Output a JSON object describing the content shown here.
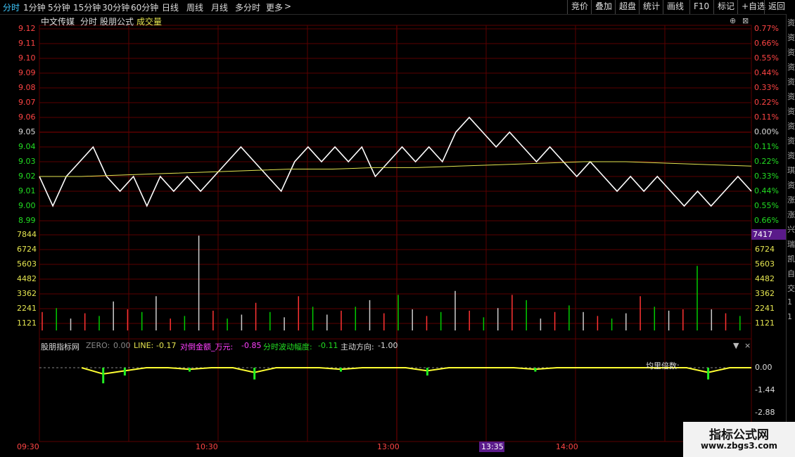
{
  "topbar": {
    "periods": [
      "分时",
      "1分钟",
      "5分钟",
      "15分钟",
      "30分钟",
      "60分钟",
      "日线",
      "周线",
      "月线",
      "多分时",
      "更多"
    ],
    "more_arrow": ">",
    "right_buttons": [
      "竞价",
      "叠加",
      "超盘",
      "统计",
      "画线",
      "F10",
      "标记",
      "+自选",
      "返回"
    ]
  },
  "chart": {
    "stock_name": "中文传媒",
    "mode": "分时",
    "formula": "股朋公式",
    "volume_label": "成交量",
    "price_ticks": [
      "9.12",
      "9.11",
      "9.10",
      "9.09",
      "9.08",
      "9.07",
      "9.06",
      "9.05",
      "9.04",
      "9.03",
      "9.02",
      "9.01",
      "9.00",
      "8.99"
    ],
    "pct_ticks": [
      "0.77%",
      "0.66%",
      "0.55%",
      "0.44%",
      "0.33%",
      "0.22%",
      "0.11%",
      "0.00%",
      "0.11%",
      "0.22%",
      "0.33%",
      "0.44%",
      "0.55%",
      "0.66%"
    ],
    "volume_ticks": [
      "7844",
      "6724",
      "5603",
      "4482",
      "3362",
      "2241",
      "1121"
    ],
    "current_volume": "7417",
    "colors": {
      "up": "#ff3333",
      "down": "#00cc00",
      "flat": "#cccccc",
      "price_line": "#ffffff",
      "avg_line": "#e6e650",
      "grid": "#5a0000"
    }
  },
  "indicator": {
    "name": "股朋指标网",
    "zero_label": "ZERO:",
    "zero_value": "0.00",
    "line_label": "LINE:",
    "line_value": "-0.17",
    "amount_label": "对倒金额_万元:",
    "amount_value": "-0.85",
    "amp_label": "分时波动幅度:",
    "amp_value": "-0.11",
    "dir_label": "主动方向:",
    "dir_value": "-1.00",
    "avg_label": "均里倍数:",
    "ticks": [
      "0.00",
      "-1.44",
      "-2.88"
    ],
    "controls": {
      "dropdown": "▼",
      "close": "×"
    }
  },
  "time_axis": {
    "labels": [
      "09:30",
      "10:30",
      "13:00",
      "13:35",
      "14:00"
    ],
    "cursor_time": "13:35"
  },
  "panel_controls": {
    "icon1": "⊕",
    "icon2": "⊠"
  },
  "watermark": {
    "title": "指标公式网",
    "url": "www.zbgs3.com"
  },
  "right_strip": [
    "资",
    "资",
    "资",
    "资",
    "资",
    "资",
    "资",
    "资",
    "资",
    "资",
    "琪",
    "资",
    "涨",
    "涨",
    "兴",
    "瑞",
    "凯",
    "自",
    "交",
    "1",
    "1"
  ],
  "chart_data": {
    "type": "line",
    "series": [
      {
        "values": [
          9.02,
          9.0,
          9.02,
          9.03,
          9.04,
          9.02,
          9.01,
          9.02,
          9.0,
          9.02,
          9.01,
          9.02,
          9.01,
          9.02,
          9.03,
          9.04,
          9.03,
          9.02,
          9.01,
          9.03,
          9.04,
          9.03,
          9.04,
          9.03,
          9.04,
          9.02,
          9.03,
          9.04,
          9.03,
          9.04,
          9.03,
          9.05,
          9.06,
          9.05,
          9.04,
          9.05,
          9.04,
          9.03,
          9.04,
          9.03,
          9.02,
          9.03,
          9.02,
          9.01,
          9.02,
          9.01,
          9.02,
          9.01,
          9.0,
          9.01,
          9.0,
          9.01,
          9.02,
          9.01
        ]
      },
      {
        "values": [
          9.02,
          9.02,
          9.021,
          9.022,
          9.023,
          9.024,
          9.025,
          9.025,
          9.026,
          9.026,
          9.027,
          9.028,
          9.029,
          9.03,
          9.03,
          9.029,
          9.028,
          9.027
        ]
      }
    ],
    "volume": [
      1400,
      1700,
      900,
      1300,
      1100,
      2200,
      1600,
      1400,
      2600,
      900,
      1100,
      7200,
      1500,
      900,
      1200,
      2100,
      1400,
      1000,
      2600,
      1800,
      1200,
      1500,
      1800,
      2300,
      1300,
      2700,
      1600,
      1100,
      1400,
      3000,
      1500,
      1000,
      1700,
      2700,
      2300,
      900,
      1400,
      1900,
      1400,
      1100,
      900,
      1300,
      2600,
      1800,
      1500,
      1600,
      4900,
      1600,
      1300,
      1100
    ],
    "indicator": [
      0,
      -0.4,
      -0.2,
      0,
      0,
      -0.1,
      0,
      0,
      -0.3,
      0,
      0,
      0,
      -0.1,
      0,
      0,
      0,
      -0.2,
      0,
      0,
      0,
      0,
      -0.1,
      0,
      0,
      0,
      0,
      0,
      0,
      0,
      -0.3,
      0,
      0
    ],
    "ylim": [
      8.99,
      9.12
    ]
  }
}
